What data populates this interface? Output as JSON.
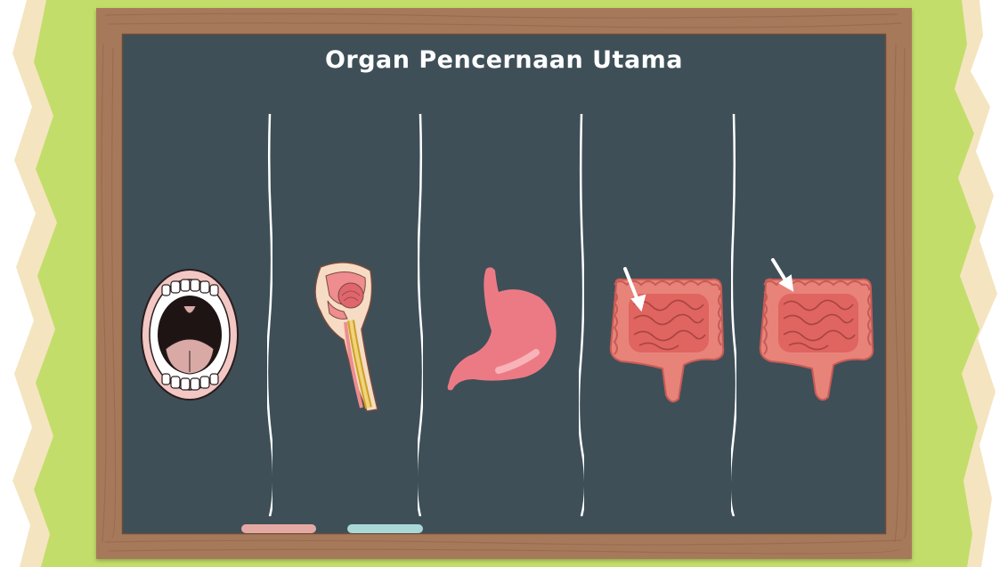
{
  "slide": {
    "title": "Organ Pencernaan Utama"
  },
  "organs": [
    {
      "icon": "mouth-icon"
    },
    {
      "icon": "throat-esophagus-icon"
    },
    {
      "icon": "stomach-icon"
    },
    {
      "icon": "small-intestine-icon"
    },
    {
      "icon": "large-intestine-icon"
    }
  ],
  "colors": {
    "background_green": "#c3dd6a",
    "paper_edge": "#f4e5c0",
    "board": "#3e4f58",
    "frame_wood": "#a7795b",
    "chalk": "#ffffff",
    "chalk_pink": "#e5a9a4",
    "chalk_teal": "#a8d8d8",
    "organ_pink": "#ec7a84",
    "intestine": "#e8837a"
  }
}
